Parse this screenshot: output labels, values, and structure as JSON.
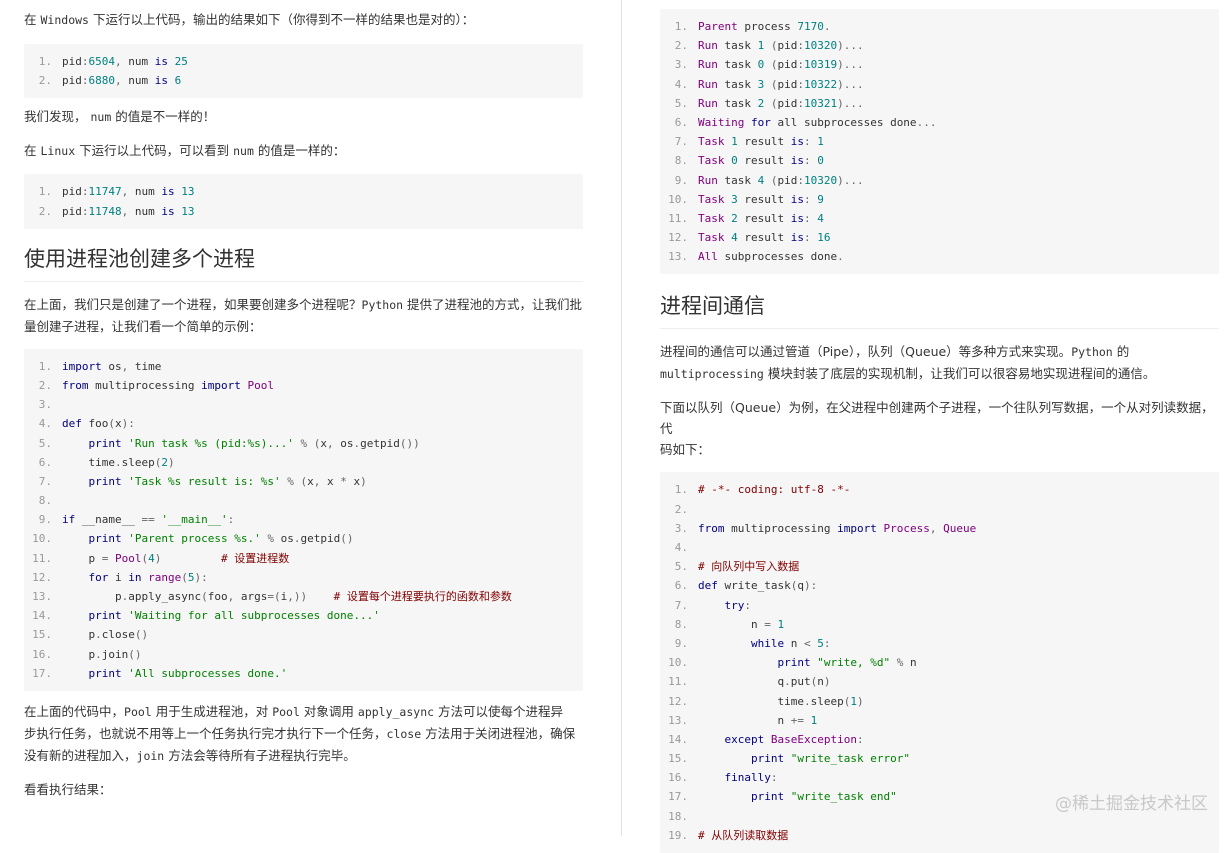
{
  "left": {
    "p1_a": "在",
    "p1_code": "Windows",
    "p1_b": "下运行以上代码，输出的结果如下（你得到不一样的结果也是对的）：",
    "code1": [
      {
        "n": "1.",
        "t": "pid:6504, num is 25"
      },
      {
        "n": "2.",
        "t": "pid:6880, num is 6"
      }
    ],
    "p2_a": "我们发现，",
    "p2_code": "num",
    "p2_b": "的值是不一样的！",
    "p3_a": "在",
    "p3_code": "Linux",
    "p3_b": "下运行以上代码，可以看到",
    "p3_code2": "num",
    "p3_c": "的值是一样的：",
    "code2": [
      {
        "n": "1.",
        "t": "pid:11747, num is 13"
      },
      {
        "n": "2.",
        "t": "pid:11748, num is 13"
      }
    ],
    "heading": "使用进程池创建多个进程",
    "p4_a": "在上面，我们只是创建了一个进程，如果要创建多个进程呢？",
    "p4_code": "Python",
    "p4_b": "提供了进程池的方式，让我们批",
    "p4_c": "量创建子进程，让我们看一个简单的示例：",
    "code3": [
      {
        "n": "1.",
        "t": "import os, time"
      },
      {
        "n": "2.",
        "t": "from multiprocessing import Pool"
      },
      {
        "n": "3.",
        "t": ""
      },
      {
        "n": "4.",
        "t": "def foo(x):"
      },
      {
        "n": "5.",
        "t": "    print 'Run task %s (pid:%s)...' % (x, os.getpid())"
      },
      {
        "n": "6.",
        "t": "    time.sleep(2)"
      },
      {
        "n": "7.",
        "t": "    print 'Task %s result is: %s' % (x, x * x)"
      },
      {
        "n": "8.",
        "t": ""
      },
      {
        "n": "9.",
        "t": "if __name__ == '__main__':"
      },
      {
        "n": "10.",
        "t": "    print 'Parent process %s.' % os.getpid()"
      },
      {
        "n": "11.",
        "t": "    p = Pool(4)         # 设置进程数"
      },
      {
        "n": "12.",
        "t": "    for i in range(5):"
      },
      {
        "n": "13.",
        "t": "        p.apply_async(foo, args=(i,))    # 设置每个进程要执行的函数和参数"
      },
      {
        "n": "14.",
        "t": "    print 'Waiting for all subprocesses done...'"
      },
      {
        "n": "15.",
        "t": "    p.close()"
      },
      {
        "n": "16.",
        "t": "    p.join()"
      },
      {
        "n": "17.",
        "t": "    print 'All subprocesses done.'"
      }
    ],
    "p5_line1_a": "在上面的代码中，",
    "p5_code1": "Pool",
    "p5_line1_b": "用于生成进程池，对",
    "p5_code2": "Pool",
    "p5_line1_c": "对象调用",
    "p5_code3": "apply_async",
    "p5_line1_d": "方法可以使每个进程异",
    "p5_line2_a": "步执行任务，也就说不用等上一个任务执行完才执行下一个任务，",
    "p5_code4": "close",
    "p5_line2_b": "方法用于关闭进程池，确保",
    "p5_line3_a": "没有新的进程加入，",
    "p5_code5": "join",
    "p5_line3_b": "方法会等待所有子进程执行完毕。",
    "p6": "看看执行结果："
  },
  "right": {
    "code4": [
      {
        "n": "1.",
        "t": "Parent process 7170."
      },
      {
        "n": "2.",
        "t": "Run task 1 (pid:10320)..."
      },
      {
        "n": "3.",
        "t": "Run task 0 (pid:10319)..."
      },
      {
        "n": "4.",
        "t": "Run task 3 (pid:10322)..."
      },
      {
        "n": "5.",
        "t": "Run task 2 (pid:10321)..."
      },
      {
        "n": "6.",
        "t": "Waiting for all subprocesses done..."
      },
      {
        "n": "7.",
        "t": "Task 1 result is: 1"
      },
      {
        "n": "8.",
        "t": "Task 0 result is: 0"
      },
      {
        "n": "9.",
        "t": "Run task 4 (pid:10320)..."
      },
      {
        "n": "10.",
        "t": "Task 3 result is: 9"
      },
      {
        "n": "11.",
        "t": "Task 2 result is: 4"
      },
      {
        "n": "12.",
        "t": "Task 4 result is: 16"
      },
      {
        "n": "13.",
        "t": "All subprocesses done."
      }
    ],
    "heading": "进程间通信",
    "p1_a": "进程间的通信可以通过管道（Pipe），队列（Queue）等多种方式来实现。",
    "p1_code": "Python",
    "p1_b": "的",
    "p1_code2": "multiprocessing",
    "p1_c": "模块封装了底层的实现机制，让我们可以很容易地实现进程间的通信。",
    "p2_a": "下面以队列（Queue）为例，在父进程中创建两个子进程，一个往队列写数据，一个从对列读数据，代",
    "p2_b": "码如下：",
    "code5": [
      {
        "n": "1.",
        "t": "# -*- coding: utf-8 -*-"
      },
      {
        "n": "2.",
        "t": ""
      },
      {
        "n": "3.",
        "t": "from multiprocessing import Process, Queue"
      },
      {
        "n": "4.",
        "t": ""
      },
      {
        "n": "5.",
        "t": "# 向队列中写入数据"
      },
      {
        "n": "6.",
        "t": "def write_task(q):"
      },
      {
        "n": "7.",
        "t": "    try:"
      },
      {
        "n": "8.",
        "t": "        n = 1"
      },
      {
        "n": "9.",
        "t": "        while n < 5:"
      },
      {
        "n": "10.",
        "t": "            print \"write, %d\" % n"
      },
      {
        "n": "11.",
        "t": "            q.put(n)"
      },
      {
        "n": "12.",
        "t": "            time.sleep(1)"
      },
      {
        "n": "13.",
        "t": "            n += 1"
      },
      {
        "n": "14.",
        "t": "    except BaseException:"
      },
      {
        "n": "15.",
        "t": "        print \"write_task error\""
      },
      {
        "n": "16.",
        "t": "    finally:"
      },
      {
        "n": "17.",
        "t": "        print \"write_task end\""
      },
      {
        "n": "18.",
        "t": ""
      },
      {
        "n": "19.",
        "t": "# 从队列读取数据"
      }
    ]
  },
  "watermark": "@稀土掘金技术社区"
}
